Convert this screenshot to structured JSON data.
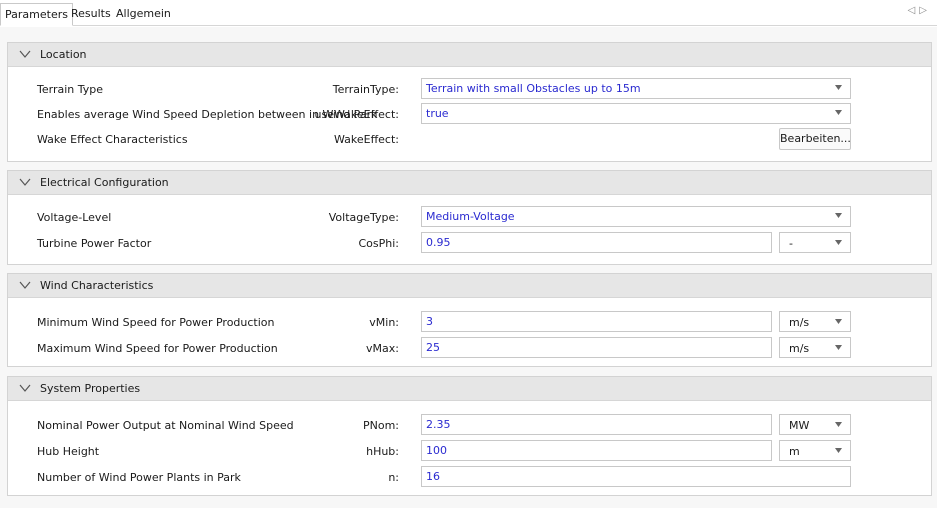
{
  "tabs": [
    "Parameters",
    "Results",
    "Allgemein"
  ],
  "tab_nav": {
    "prev": "◁",
    "next": "▷"
  },
  "groups": {
    "location": {
      "title": "Location",
      "rows": {
        "terrain": {
          "label": "Terrain Type",
          "key": "TerrainType:",
          "value": "Terrain with small Obstacles up to 15m"
        },
        "wake": {
          "label": "Enables average Wind Speed Depletion between in Wind Park",
          "key": "useWakeEffect:",
          "value": "true"
        },
        "wakechar": {
          "label": "Wake Effect Characteristics",
          "key": "WakeEffect:",
          "button": "Bearbeiten..."
        }
      }
    },
    "electrical": {
      "title": "Electrical Configuration",
      "rows": {
        "voltage": {
          "label": "Voltage-Level",
          "key": "VoltageType:",
          "value": "Medium-Voltage"
        },
        "cosphi": {
          "label": "Turbine Power Factor",
          "key": "CosPhi:",
          "value": "0.95",
          "unit": "-"
        }
      }
    },
    "wind": {
      "title": "Wind Characteristics",
      "rows": {
        "vmin": {
          "label": "Minimum Wind Speed for Power Production",
          "key": "vMin:",
          "value": "3",
          "unit": "m/s"
        },
        "vmax": {
          "label": "Maximum Wind Speed for Power Production",
          "key": "vMax:",
          "value": "25",
          "unit": "m/s"
        }
      }
    },
    "system": {
      "title": "System Properties",
      "rows": {
        "pnom": {
          "label": "Nominal Power Output at Nominal Wind Speed",
          "key": "PNom:",
          "value": "2.35",
          "unit": "MW"
        },
        "hhub": {
          "label": "Hub Height",
          "key": "hHub:",
          "value": "100",
          "unit": "m"
        },
        "n": {
          "label": "Number of Wind Power Plants in Park",
          "key": "n:",
          "value": "16"
        }
      }
    }
  },
  "colors": {
    "value_text": "#2a2ad0",
    "header_bg": "#e6e6e6",
    "border": "#c8c8c8"
  },
  "icons": {
    "group_toggle": "chevron-down-icon",
    "dropdown": "dropdown-caret-icon"
  }
}
